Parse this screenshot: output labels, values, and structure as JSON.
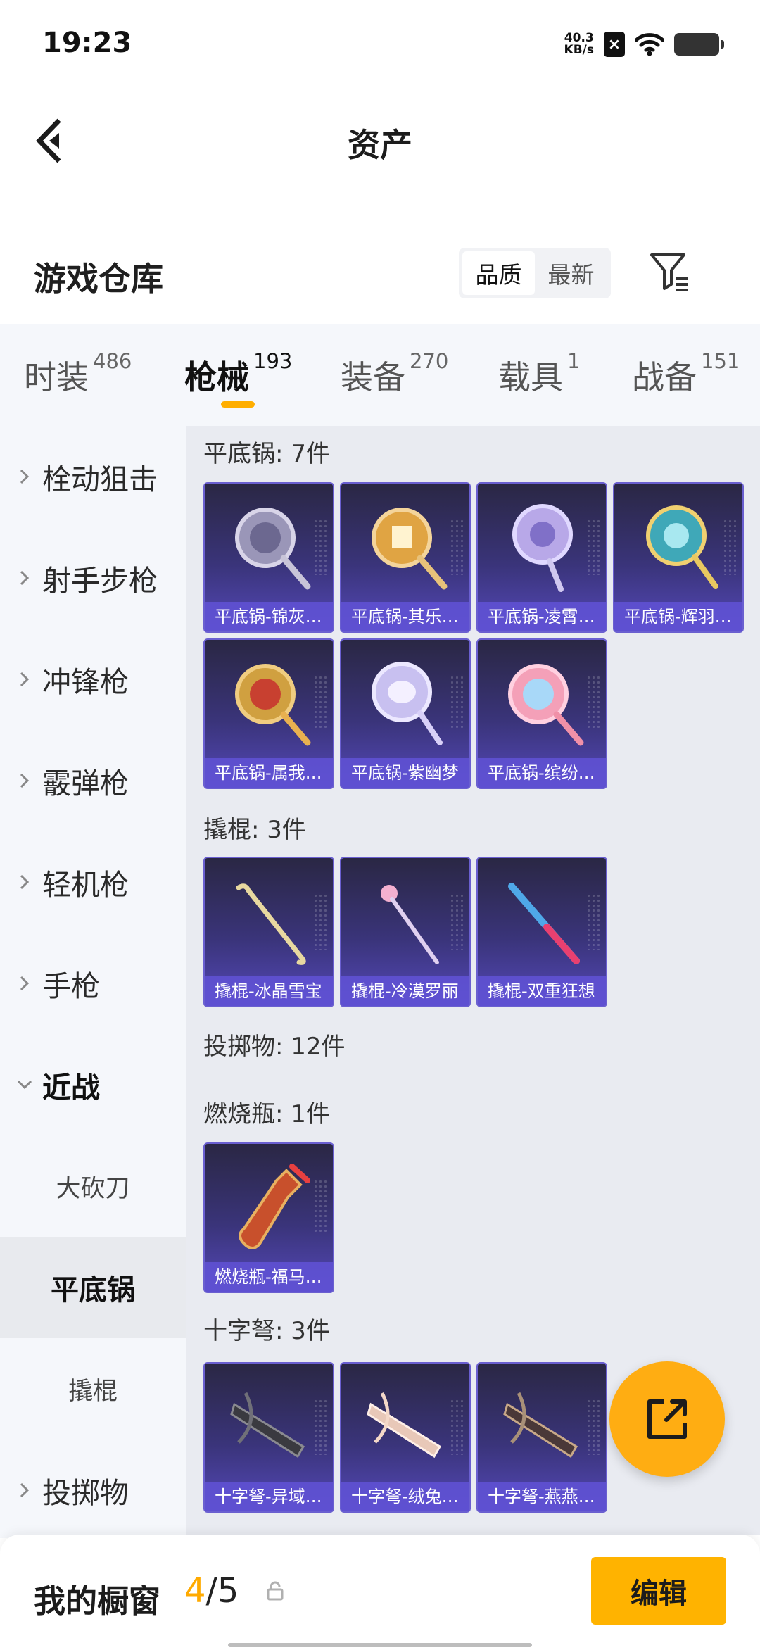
{
  "status_bar": {
    "time": "19:23",
    "net_speed_value": "40.3",
    "net_speed_unit": "KB/s"
  },
  "nav": {
    "title": "资产"
  },
  "warehouse": {
    "title": "游戏仓库",
    "sort_options": [
      "品质",
      "最新"
    ],
    "active_sort": "品质"
  },
  "tabs": [
    {
      "label": "时装",
      "count": "486"
    },
    {
      "label": "枪械",
      "count": "193",
      "active": true
    },
    {
      "label": "装备",
      "count": "270"
    },
    {
      "label": "载具",
      "count": "1"
    },
    {
      "label": "战备",
      "count": "151"
    }
  ],
  "sidebar": {
    "items": [
      {
        "label": "栓动狙击"
      },
      {
        "label": "射手步枪"
      },
      {
        "label": "冲锋枪"
      },
      {
        "label": "霰弹枪"
      },
      {
        "label": "轻机枪"
      },
      {
        "label": "手枪"
      },
      {
        "label": "近战",
        "expanded": true
      }
    ],
    "subitems": [
      {
        "label": "大砍刀"
      },
      {
        "label": "平底锅",
        "active": true
      },
      {
        "label": "撬棍"
      }
    ],
    "after_items": [
      {
        "label": "投掷物"
      }
    ]
  },
  "content": {
    "sections": [
      {
        "label": "平底锅: 7件",
        "items": [
          "平底锅-锦灰…",
          "平底锅-其乐…",
          "平底锅-凌霄…",
          "平底锅-辉羽…",
          "平底锅-属我…",
          "平底锅-紫幽梦",
          "平底锅-缤纷…"
        ]
      },
      {
        "label": "撬棍: 3件",
        "items": [
          "撬棍-冰晶雪宝",
          "撬棍-冷漠罗丽",
          "撬棍-双重狂想"
        ]
      },
      {
        "label": "投掷物: 12件",
        "items": []
      },
      {
        "label": "燃烧瓶: 1件",
        "items": [
          "燃烧瓶-福马…"
        ]
      },
      {
        "label": "十字弩: 3件",
        "items": [
          "十字弩-异域…",
          "十字弩-绒兔…",
          "十字弩-燕燕…"
        ]
      }
    ]
  },
  "bottom_bar": {
    "title": "我的橱窗",
    "count_current": "4",
    "count_separator": "/5",
    "edit_label": "编辑"
  },
  "colors": {
    "accent": "#ffae00",
    "card_base": "#3a347a",
    "card_label": "#6052d6"
  }
}
